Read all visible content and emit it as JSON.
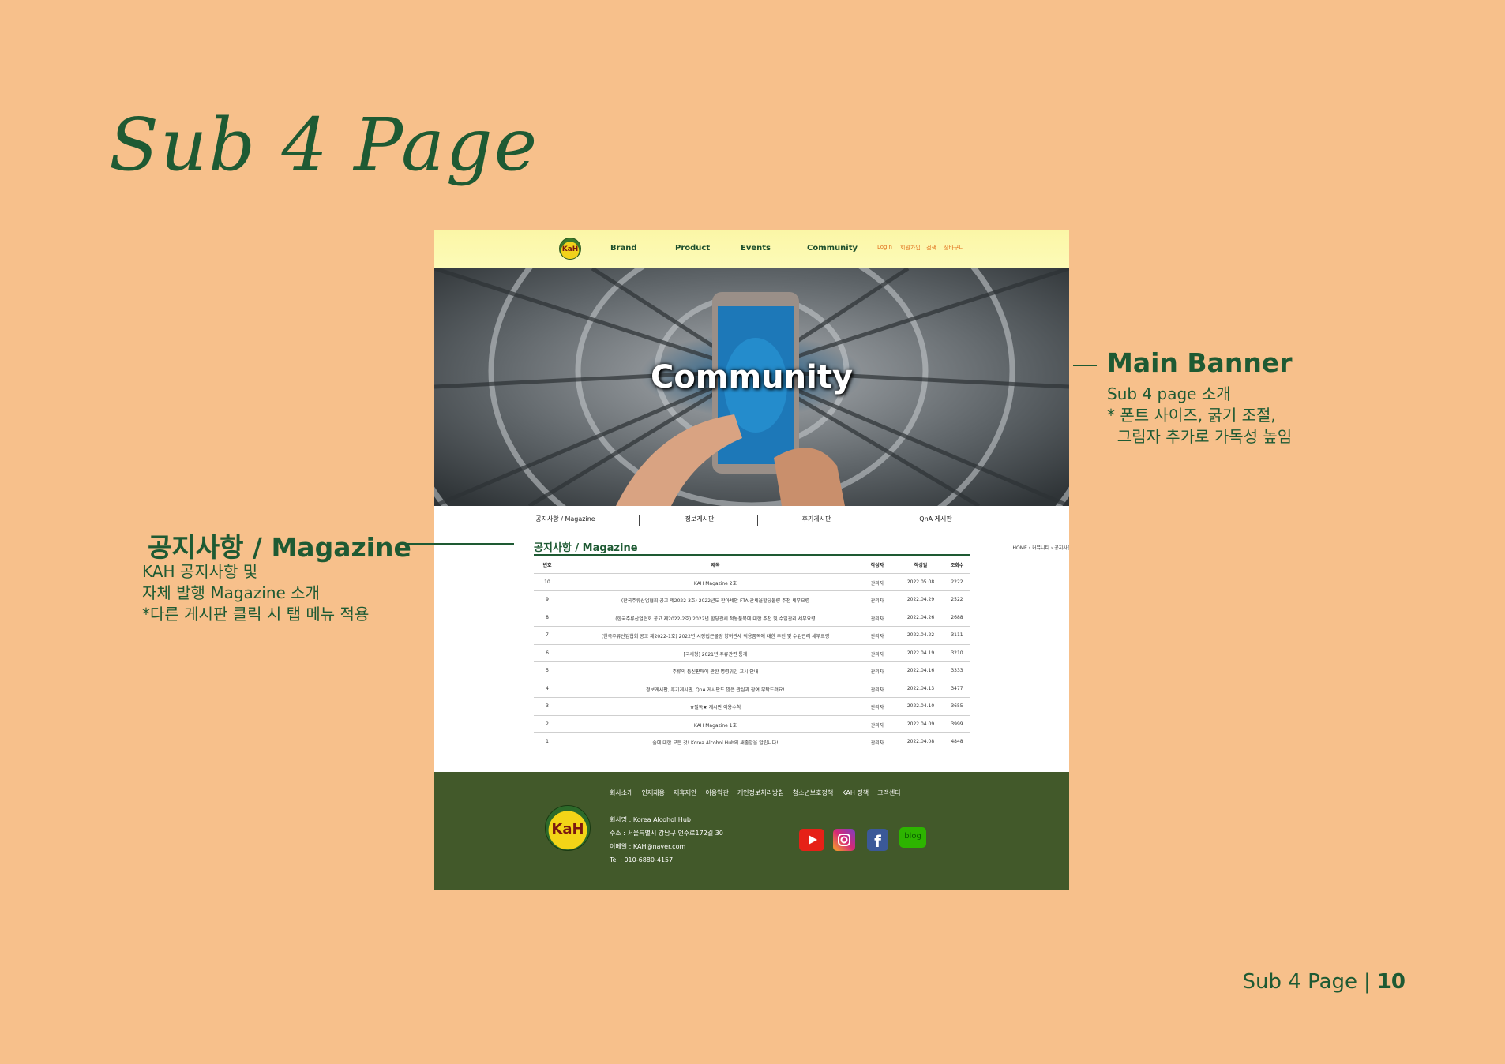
{
  "slide": {
    "title": "Sub 4 Page",
    "page_label": "Sub 4 Page",
    "page_sep": "|",
    "page_number": "10"
  },
  "annotations": {
    "banner": {
      "heading": "Main Banner",
      "lines": [
        "Sub 4 page 소개",
        "* 폰트 사이즈, 굵기 조절,",
        "  그림자 추가로 가독성 높임"
      ]
    },
    "board": {
      "heading": "공지사항 / Magazine",
      "lines": [
        "KAH 공지사항 및",
        "자체 발행 Magazine 소개",
        "*다른 게시판 클릭 시 탭 메뉴 적용"
      ]
    }
  },
  "site": {
    "logo_text": "KaH",
    "nav": [
      "Brand",
      "Product",
      "Events",
      "Community"
    ],
    "util": [
      "Login",
      "회원가입",
      "검색",
      "장바구니"
    ],
    "banner_title": "Community",
    "tabs": [
      "공지사항 / Magazine",
      "정보게시판",
      "후기게시판",
      "QnA 게시판"
    ],
    "board_title": "공지사항 / Magazine",
    "breadcrumb": "HOME › 커뮤니티 › 공지사항/Magazine",
    "columns": [
      "번호",
      "제목",
      "작성자",
      "작성일",
      "조회수"
    ],
    "rows": [
      {
        "no": "10",
        "title": "KAH Magazine 2호",
        "author": "관리자",
        "date": "2022.05.08",
        "views": "2222"
      },
      {
        "no": "9",
        "title": "(한국주류산업협회 공고 제2022-3호) 2022년도 한아세안 FTA 관세율할당물량 추천 세부요령",
        "author": "관리자",
        "date": "2022.04.29",
        "views": "2522"
      },
      {
        "no": "8",
        "title": "(한국주류산업협회 공고 제2022-2호) 2022년 할당관세 적용품목에 대한 추천 및 수입관리 세부요령",
        "author": "관리자",
        "date": "2022.04.26",
        "views": "2688"
      },
      {
        "no": "7",
        "title": "(한국주류산업협회 공고 제2022-1호) 2022년 시장접근물량 양허관세 적용품목에 대한 추천 및 수입관리 세부요령",
        "author": "관리자",
        "date": "2022.04.22",
        "views": "3111"
      },
      {
        "no": "6",
        "title": "[국세청] 2021년 주류관련 통계",
        "author": "관리자",
        "date": "2022.04.19",
        "views": "3210"
      },
      {
        "no": "5",
        "title": "주류의 통신판매에 관한 명령위임 고시 안내",
        "author": "관리자",
        "date": "2022.04.16",
        "views": "3333"
      },
      {
        "no": "4",
        "title": "정보게시판, 후기게시판, QnA 게시판도 많은 관심과 참여 부탁드려요!",
        "author": "관리자",
        "date": "2022.04.13",
        "views": "3477"
      },
      {
        "no": "3",
        "title": "★필독★ 게시판 이용수칙",
        "author": "관리자",
        "date": "2022.04.10",
        "views": "3655"
      },
      {
        "no": "2",
        "title": "KAH Magazine 1호",
        "author": "관리자",
        "date": "2022.04.09",
        "views": "3999"
      },
      {
        "no": "1",
        "title": "술에 대한 모든 것! Korea Alcohol Hub의 새출발을 알립니다!",
        "author": "관리자",
        "date": "2022.04.08",
        "views": "4848"
      }
    ],
    "footer_links": [
      "회사소개",
      "인재채용",
      "제휴제안",
      "이용약관",
      "개인정보처리방침",
      "청소년보호정책",
      "KAH 정책",
      "고객센터"
    ],
    "footer_logo": "KaH",
    "footer_info": [
      "회사명 : Korea Alcohol Hub",
      "주소 : 서울특별시 강남구 언주로172길 30",
      "이메일 : KAH@naver.com",
      "Tel : 010-6880-4157"
    ],
    "social": [
      {
        "icon": "youtube-icon",
        "color": "#e62117",
        "label": ""
      },
      {
        "icon": "instagram-icon",
        "color": "#c13584",
        "label": ""
      },
      {
        "icon": "facebook-icon",
        "color": "#3b5998",
        "label": "f"
      },
      {
        "icon": "blog-icon",
        "color": "#2db400",
        "label": "blog"
      }
    ]
  }
}
